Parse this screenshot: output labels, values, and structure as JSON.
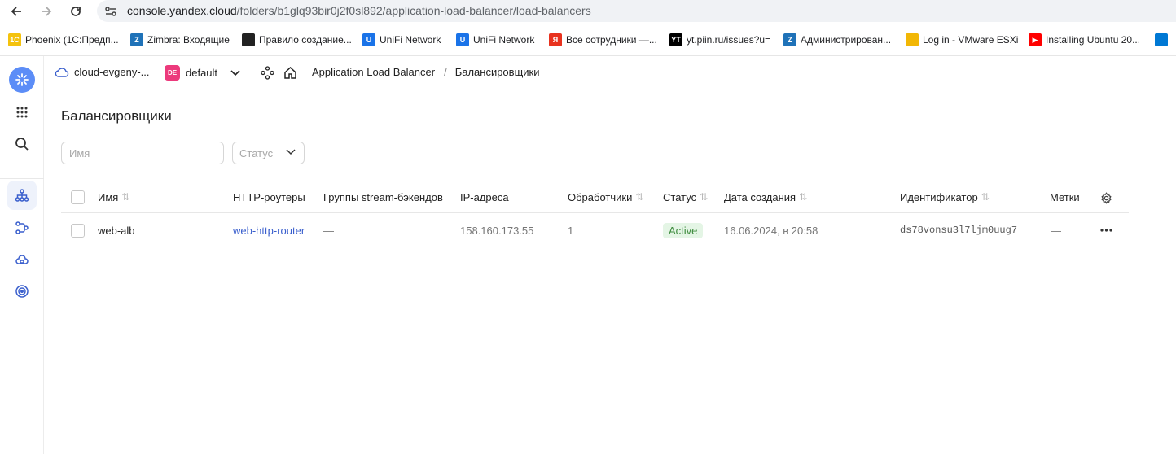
{
  "browser": {
    "url_host": "console.yandex.cloud",
    "url_path": "/folders/b1glq93bir0j2f0sl892/application-load-balancer/load-balancers",
    "bookmarks": [
      {
        "label": "Phoenix (1С:Предп...",
        "icon": "1c-icon",
        "color": "#f4c20d",
        "glyph": "1С"
      },
      {
        "label": "Zimbra: Входящие",
        "icon": "zimbra-icon",
        "color": "#1f72b8",
        "glyph": "Z"
      },
      {
        "label": "Правило создание...",
        "icon": "globe-icon",
        "color": "#222222",
        "glyph": ""
      },
      {
        "label": "UniFi Network",
        "icon": "unifi-icon",
        "color": "#1a73e8",
        "glyph": "U"
      },
      {
        "label": "UniFi Network",
        "icon": "unifi-icon",
        "color": "#1a73e8",
        "glyph": "U"
      },
      {
        "label": "Все сотрудники —...",
        "icon": "yandex-icon",
        "color": "#e8321e",
        "glyph": "Я"
      },
      {
        "label": "yt.piin.ru/issues?u=",
        "icon": "youtrack-icon",
        "color": "#000000",
        "glyph": "YT"
      },
      {
        "label": "Администрирован...",
        "icon": "zimbra-icon",
        "color": "#1f72b8",
        "glyph": "Z"
      },
      {
        "label": "Log in - VMware ESXi",
        "icon": "vmware-icon",
        "color": "#f2b705",
        "glyph": ""
      },
      {
        "label": "Installing Ubuntu 20...",
        "icon": "youtube-icon",
        "color": "#ff0000",
        "glyph": "▶"
      },
      {
        "label": "",
        "icon": "azure-icon",
        "color": "#0078d4",
        "glyph": ""
      }
    ]
  },
  "header": {
    "cloud": "cloud-evgeny-...",
    "folder_badge": "DE",
    "folder": "default",
    "crumb_service": "Application Load Balancer",
    "crumb_sep": "/",
    "crumb_page": "Балансировщики"
  },
  "page": {
    "title": "Балансировщики",
    "name_placeholder": "Имя",
    "status_placeholder": "Статус"
  },
  "table": {
    "columns": {
      "name": "Имя",
      "routers": "HTTP-роутеры",
      "stream": "Группы stream-бэкендов",
      "ip": "IP-адреса",
      "handlers": "Обработчики",
      "status": "Статус",
      "created": "Дата создания",
      "id": "Идентификатор",
      "labels": "Метки"
    },
    "rows": [
      {
        "name": "web-alb",
        "router": "web-http-router",
        "stream": "—",
        "ip": "158.160.173.55",
        "handlers": "1",
        "status": "Active",
        "created": "16.06.2024, в 20:58",
        "id": "ds78vonsu3l7ljm0uug7",
        "labels": "—"
      }
    ]
  },
  "colors": {
    "accent": "#5c8df7",
    "link": "#3a5fcd",
    "status_active_bg": "#e4f5e5",
    "status_active_fg": "#3d8b3d",
    "folder_badge": "#ec3a7c"
  }
}
